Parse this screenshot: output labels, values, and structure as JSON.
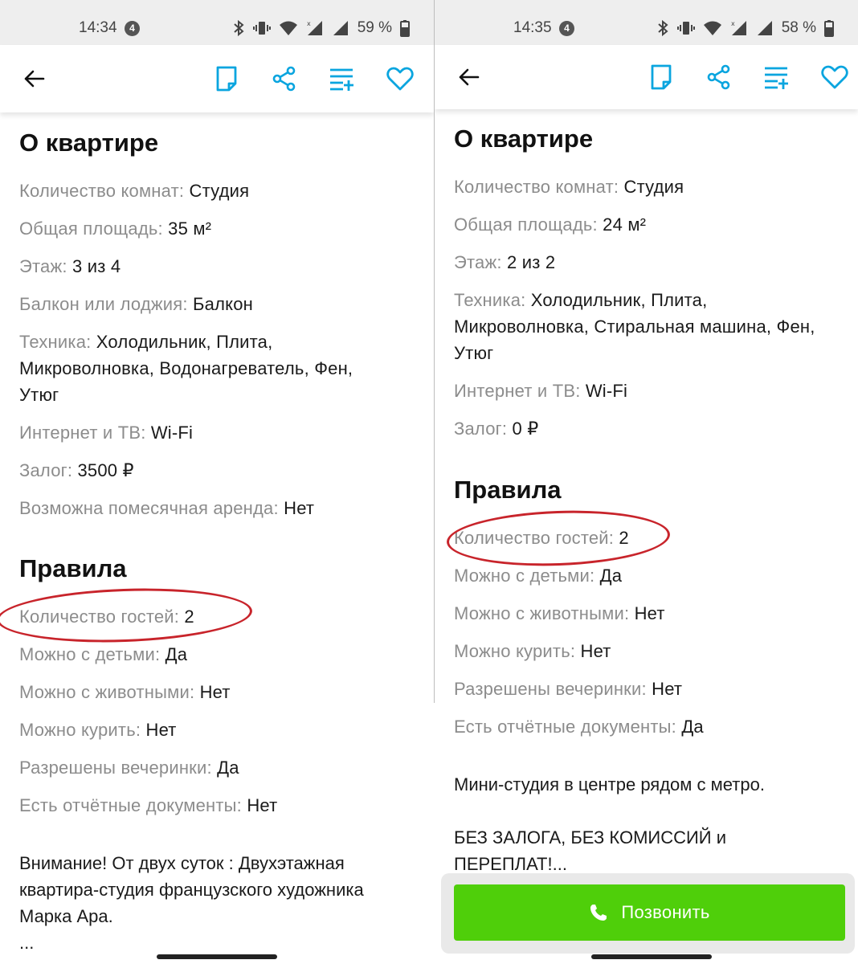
{
  "colors": {
    "accent": "#0aa5df",
    "call_green": "#4fcf0a",
    "annotation_red": "#c8242b"
  },
  "left": {
    "status": {
      "time": "14:34",
      "notif_count": "4",
      "battery": "59 %"
    },
    "about_title": "О квартире",
    "about": [
      {
        "label": "Количество комнат:",
        "value": "Студия"
      },
      {
        "label": "Общая площадь:",
        "value": "35 м²"
      },
      {
        "label": "Этаж:",
        "value": "3 из 4"
      },
      {
        "label": "Балкон или лоджия:",
        "value": "Балкон"
      },
      {
        "label": "Техника:",
        "value": "Холодильник, Плита, Микроволновка, Водонагреватель, Фен, Утюг"
      },
      {
        "label": "Интернет и ТВ:",
        "value": "Wi-Fi"
      },
      {
        "label": "Залог:",
        "value": "3500 ₽"
      },
      {
        "label": "Возможна помесячная аренда:",
        "value": "Нет"
      }
    ],
    "rules_title": "Правила",
    "rules": [
      {
        "label": "Количество гостей:",
        "value": "2"
      },
      {
        "label": "Можно с детьми:",
        "value": "Да"
      },
      {
        "label": "Можно с животными:",
        "value": "Нет"
      },
      {
        "label": "Можно курить:",
        "value": "Нет"
      },
      {
        "label": "Разрешены вечеринки:",
        "value": "Да"
      },
      {
        "label": "Есть отчётные документы:",
        "value": "Нет"
      }
    ],
    "description": "Внимание! От двух суток : Двухэтажная квартира-студия французского художника Марка Ара.",
    "description_more": "..."
  },
  "right": {
    "status": {
      "time": "14:35",
      "notif_count": "4",
      "battery": "58 %"
    },
    "about_title": "О квартире",
    "about": [
      {
        "label": "Количество комнат:",
        "value": "Студия"
      },
      {
        "label": "Общая площадь:",
        "value": "24 м²"
      },
      {
        "label": "Этаж:",
        "value": "2 из 2"
      },
      {
        "label": "Техника:",
        "value": "Холодильник, Плита, Микроволновка, Стиральная машина, Фен, Утюг"
      },
      {
        "label": "Интернет и ТВ:",
        "value": "Wi-Fi"
      },
      {
        "label": "Залог:",
        "value": "0 ₽"
      }
    ],
    "rules_title": "Правила",
    "rules": [
      {
        "label": "Количество гостей:",
        "value": "2"
      },
      {
        "label": "Можно с детьми:",
        "value": "Да"
      },
      {
        "label": "Можно с животными:",
        "value": "Нет"
      },
      {
        "label": "Можно курить:",
        "value": "Нет"
      },
      {
        "label": "Разрешены вечеринки:",
        "value": "Нет"
      },
      {
        "label": "Есть отчётные документы:",
        "value": "Да"
      }
    ],
    "description_line1": "Мини-студия в центре рядом с метро.",
    "description_line2": "БЕЗ ЗАЛОГА, БЕЗ КОМИССИЙ и ПЕРЕПЛАТ!...",
    "call_label": "Позвонить"
  },
  "icons": {
    "back": "arrow-left-icon",
    "note": "note-icon",
    "share": "share-icon",
    "compare": "compare-list-icon",
    "favorite": "heart-icon",
    "phone": "phone-icon"
  }
}
